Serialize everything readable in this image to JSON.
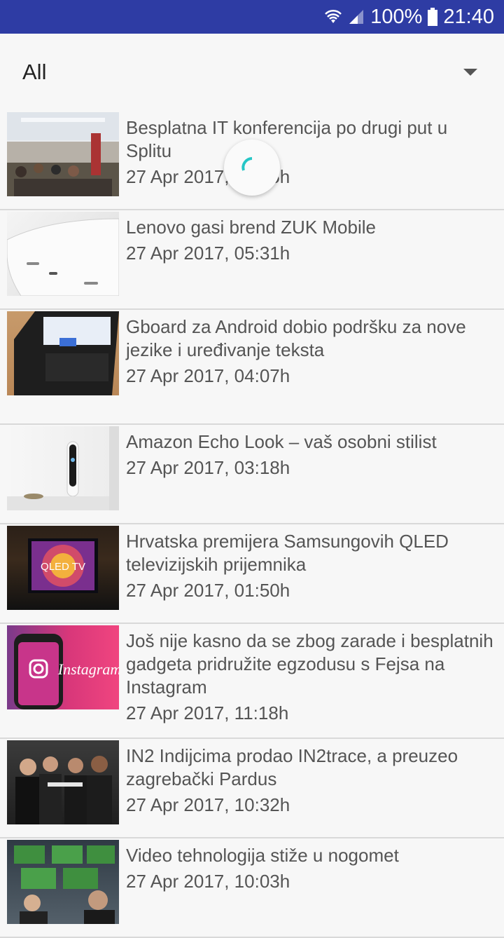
{
  "status_bar": {
    "battery": "100%",
    "time": "21:40",
    "icons": [
      "wifi-icon",
      "signal-icon",
      "battery-icon"
    ]
  },
  "filter": {
    "selected": "All"
  },
  "articles": [
    {
      "title": "Besplatna IT konferencija po drugi put u Splitu",
      "date": "27 Apr 2017, 05:55h"
    },
    {
      "title": "Lenovo gasi brend ZUK Mobile",
      "date": "27 Apr 2017, 05:31h"
    },
    {
      "title": "Gboard za Android dobio podršku za nove jezike i uređivanje teksta",
      "date": "27 Apr 2017, 04:07h"
    },
    {
      "title": "Amazon Echo Look – vaš osobni stilist",
      "date": "27 Apr 2017, 03:18h"
    },
    {
      "title": "Hrvatska premijera Samsungovih QLED televizijskih prijemnika",
      "date": "27 Apr 2017, 01:50h"
    },
    {
      "title": "Još nije kasno da se zbog zarade i besplatnih gadgeta pridružite egzodusu s Fejsa na Instagram",
      "date": "27 Apr 2017, 11:18h"
    },
    {
      "title": "IN2 Indijcima prodao IN2trace, a preuzeo zagrebački Pardus",
      "date": "27 Apr 2017, 10:32h"
    },
    {
      "title": "Video tehnologija stiže u nogomet",
      "date": "27 Apr 2017, 10:03h"
    }
  ],
  "thumbnail_texts": {
    "tv": "QLED TV",
    "instagram": "Instagram"
  },
  "colors": {
    "status_bar": "#2e3ca4",
    "spinner_accent": "#26c6c6"
  }
}
